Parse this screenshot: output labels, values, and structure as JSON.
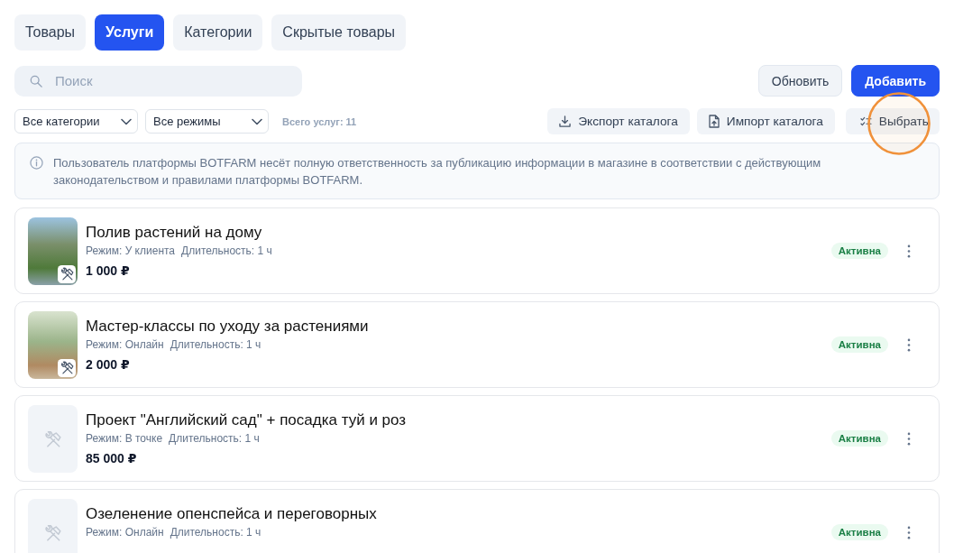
{
  "tabs": [
    {
      "label": "Товары",
      "selected": false
    },
    {
      "label": "Услуги",
      "selected": true
    },
    {
      "label": "Категории",
      "selected": false
    },
    {
      "label": "Скрытые товары",
      "selected": false
    }
  ],
  "search": {
    "placeholder": "Поиск"
  },
  "actions": [
    {
      "label": "Обновить",
      "kind": "secondary"
    },
    {
      "label": "Добавить",
      "kind": "primary"
    }
  ],
  "filters": [
    {
      "value": "Все категории"
    },
    {
      "value": "Все режимы"
    }
  ],
  "total": "Всего услуг: 11",
  "tools": [
    {
      "label": "Экспорт каталога",
      "kind": "export"
    },
    {
      "label": "Импорт каталога",
      "kind": "import"
    },
    {
      "label": "Выбрать",
      "kind": "select"
    }
  ],
  "annotation": {
    "kind": "circle"
  },
  "notice": {
    "text": "Пользователь платформы BOTFARM несёт полную ответственность за публикацию информации в магазине в соответствии с действующим законодательством и правилами платформы BOTFARM."
  },
  "services": [
    {
      "title": "Полив растений на дому",
      "mode": "Режим: У клиента",
      "duration": "Длительность: 1 ч",
      "price": "1 000 ₽",
      "photo": true,
      "status": "Активна",
      "active": true
    },
    {
      "title": "Мастер-классы по уходу за растениями",
      "mode": "Режим: Онлайн",
      "duration": "Длительность: 1 ч",
      "price": "2 000 ₽",
      "photo": true,
      "status": "Активна",
      "active": true
    },
    {
      "title": "Проект \"Английский сад\" + посадка туй и роз",
      "mode": "Режим: В точке",
      "duration": "Длительность: 1 ч",
      "price": "85 000 ₽",
      "photo": false,
      "status": "Активна",
      "active": true
    },
    {
      "title": "Озеленение опенспейса и переговорных",
      "mode": "Режим: Онлайн",
      "duration": "Длительность: 1 ч",
      "photo": false,
      "status": "Активна",
      "active": true
    }
  ]
}
